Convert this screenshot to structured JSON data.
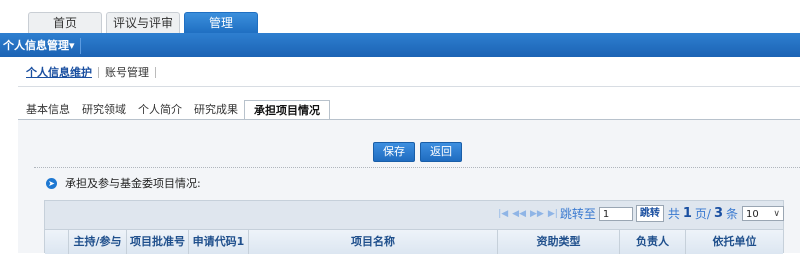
{
  "top_tabs": [
    {
      "label": "首页",
      "active": false
    },
    {
      "label": "评议与评审",
      "active": false
    },
    {
      "label": "管理",
      "active": true
    }
  ],
  "menu": {
    "label": "个人信息管理",
    "caret": "▾"
  },
  "sub_nav": {
    "active": "个人信息维护",
    "other": "账号管理"
  },
  "content_tabs": [
    {
      "label": "基本信息"
    },
    {
      "label": "研究领域"
    },
    {
      "label": "个人简介"
    },
    {
      "label": "研究成果"
    },
    {
      "label": "承担项目情况",
      "active": true
    }
  ],
  "actions": {
    "save": "保存",
    "back": "返回"
  },
  "section": {
    "title": "承担及参与基金委项目情况:",
    "icon": "arrow-circle-icon"
  },
  "pager": {
    "jump_label": "跳转至",
    "page_input": "1",
    "go_label": "跳转",
    "total_prefix": "共",
    "total_pages": "1",
    "page_suffix": "页/",
    "total_records": "3",
    "record_suffix": "条",
    "page_size": "10"
  },
  "table": {
    "columns": [
      "",
      "主持/参与",
      "项目批准号",
      "申请代码1",
      "项目名称",
      "资助类型",
      "负责人",
      "依托单位"
    ]
  },
  "colors": {
    "accent": "#1f6fc2",
    "header_text": "#1f4f8c",
    "link": "#1a4fa0"
  }
}
